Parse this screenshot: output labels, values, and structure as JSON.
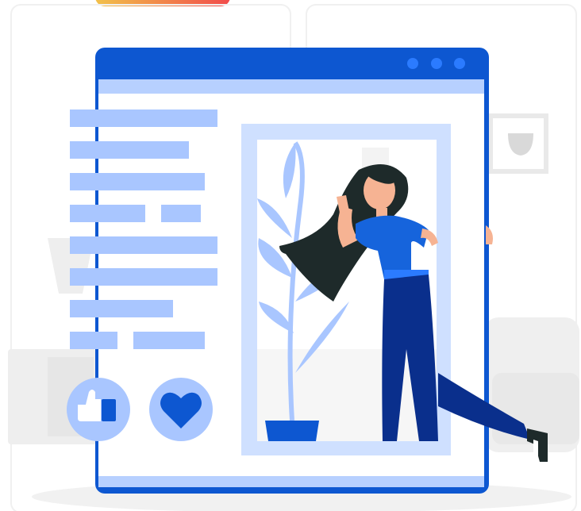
{
  "colors": {
    "window_blue": "#0d57d1",
    "window_header_light": "#b7d0ff",
    "text_bar": "#a9c6ff",
    "photo_frame": "#cfe0ff",
    "background_gray": "#f2f2f2",
    "hair": "#1e2a2a",
    "shirt": "#1664dc",
    "jeans": "#0a2f8c",
    "skin": "#f6b393",
    "accent_gradient_start": "#f2c14a",
    "accent_gradient_end": "#f24b4b"
  },
  "window": {
    "header_dots": 3
  },
  "icons": {
    "like": "thumbs-up-icon",
    "love": "heart-icon",
    "frame": "wall-frame-icon"
  }
}
